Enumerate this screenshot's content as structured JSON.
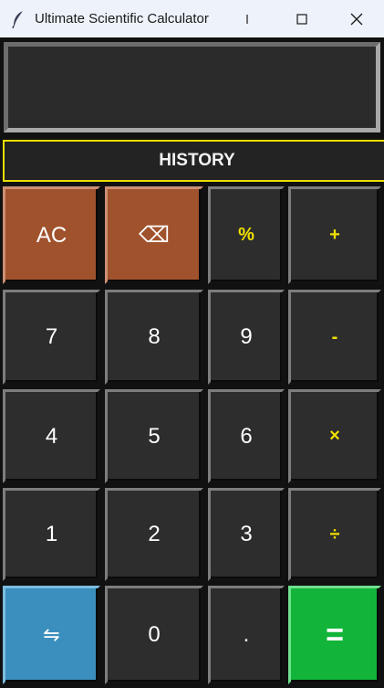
{
  "window": {
    "title": "Ultimate Scientific Calculator",
    "app_icon": "feather-icon",
    "controls": [
      "minimize-icon",
      "maximize-icon",
      "close-icon"
    ]
  },
  "display": {
    "value": ""
  },
  "history": {
    "label": "HISTORY"
  },
  "keys": {
    "ac": "AC",
    "backspace": "⌫",
    "percent": "%",
    "add": "+",
    "seven": "7",
    "eight": "8",
    "nine": "9",
    "subtract": "-",
    "four": "4",
    "five": "5",
    "six": "6",
    "multiply": "×",
    "one": "1",
    "two": "2",
    "three": "3",
    "divide": "÷",
    "swap": "⇋",
    "zero": "0",
    "decimal": ".",
    "equals": "="
  },
  "colors": {
    "background": "#111111",
    "key": "#2d2d2d",
    "operator_text": "#f0e000",
    "danger_key": "#a0522d",
    "swap_key": "#3b8fbe",
    "equals_key": "#12b53a",
    "history_border": "#e8de00"
  }
}
